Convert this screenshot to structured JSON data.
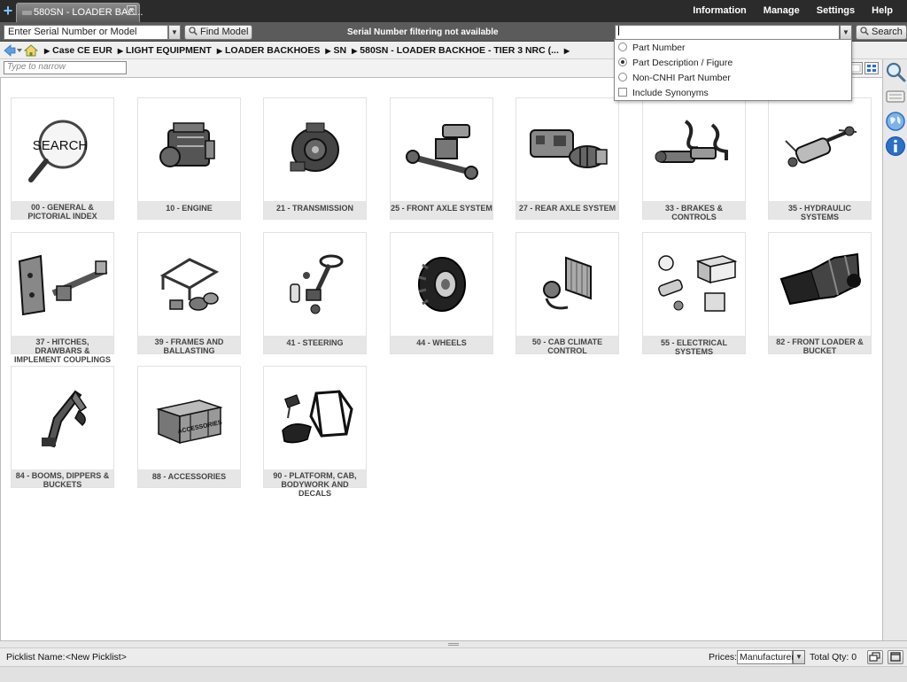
{
  "tab": {
    "title": "580SN - LOADER BAC...",
    "close": "x"
  },
  "top_menu": [
    "Information",
    "Manage",
    "Settings",
    "Help"
  ],
  "toolbar": {
    "serial_value": "Enter Serial Number or Model",
    "find_model_label": "Find Model",
    "serial_status": "Serial Number filtering not available",
    "search_value": "",
    "search_label": "Search"
  },
  "breadcrumb": [
    "Case CE EUR",
    "LIGHT EQUIPMENT",
    "LOADER BACKHOES",
    "SN",
    "580SN - LOADER BACKHOE - TIER 3 NRC (..."
  ],
  "filter": {
    "placeholder": "Type to narrow"
  },
  "search_options": {
    "items": [
      {
        "label": "Part Number",
        "type": "radio",
        "selected": false
      },
      {
        "label": "Part Description / Figure",
        "type": "radio",
        "selected": true
      },
      {
        "label": "Non-CNHI Part Number",
        "type": "radio",
        "selected": false
      },
      {
        "label": "Include Synonyms",
        "type": "checkbox",
        "selected": false
      }
    ]
  },
  "categories": [
    {
      "label": "00 - GENERAL & PICTORIAL INDEX",
      "icon": "search-magnifier-icon",
      "thumb_text": "SEARCH"
    },
    {
      "label": "10 - ENGINE",
      "icon": "engine-icon"
    },
    {
      "label": "21 - TRANSMISSION",
      "icon": "transmission-icon"
    },
    {
      "label": "25 - FRONT AXLE SYSTEM",
      "icon": "front-axle-icon"
    },
    {
      "label": "27 - REAR AXLE SYSTEM",
      "icon": "rear-axle-icon"
    },
    {
      "label": "33 - BRAKES & CONTROLS",
      "icon": "brakes-icon"
    },
    {
      "label": "35 - HYDRAULIC SYSTEMS",
      "icon": "hydraulic-cylinder-icon"
    },
    {
      "label": "37 - HITCHES, DRAWBARS & IMPLEMENT COUPLINGS",
      "icon": "hitch-icon"
    },
    {
      "label": "39 - FRAMES AND BALLASTING",
      "icon": "frame-icon"
    },
    {
      "label": "41 - STEERING",
      "icon": "steering-icon"
    },
    {
      "label": "44 - WHEELS",
      "icon": "wheel-icon"
    },
    {
      "label": "50 - CAB CLIMATE CONTROL",
      "icon": "radiator-icon"
    },
    {
      "label": "55 - ELECTRICAL SYSTEMS",
      "icon": "battery-icon"
    },
    {
      "label": "82 - FRONT LOADER & BUCKET",
      "icon": "loader-bucket-icon"
    },
    {
      "label": "84 - BOOMS, DIPPERS & BUCKETS",
      "icon": "boom-icon"
    },
    {
      "label": "88 - ACCESSORIES",
      "icon": "crate-icon",
      "thumb_text": "ACCESSORIES"
    },
    {
      "label": "90 - PLATFORM, CAB, BODYWORK AND DECALS",
      "icon": "cab-icon"
    }
  ],
  "bottom": {
    "picklist_label": "Picklist Name:",
    "picklist_value": "<New Picklist>",
    "prices_label": "Prices:",
    "prices_value": "Manufacturer",
    "total_qty": "Total Qty: 0"
  },
  "colors": {
    "topbar": "#2b2b2b",
    "toolbar": "#5b5b5b",
    "accent_blue": "#2a6fc9"
  }
}
